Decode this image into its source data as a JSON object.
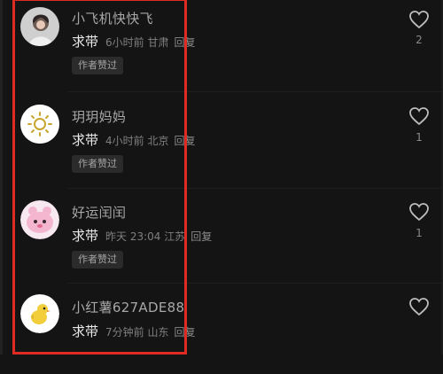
{
  "comments": [
    {
      "username": "小飞机快快飞",
      "content": "求带",
      "time": "6小时前",
      "location": "甘肃",
      "reply": "回复",
      "badge": "作者赞过",
      "likes": "2",
      "avatar": "portrait-avatar"
    },
    {
      "username": "玥玥妈妈",
      "content": "求带",
      "time": "4小时前",
      "location": "北京",
      "reply": "回复",
      "badge": "作者赞过",
      "likes": "1",
      "avatar": "sun-avatar"
    },
    {
      "username": "好运闰闰",
      "content": "求带",
      "time": "昨天 23:04",
      "location": "江苏",
      "reply": "回复",
      "badge": "作者赞过",
      "likes": "1",
      "avatar": "pink-character-avatar"
    },
    {
      "username": "小红薯627ADE88",
      "content": "求带",
      "time": "7分钟前",
      "location": "山东",
      "reply": "回复",
      "avatar": "chick-avatar"
    }
  ],
  "colors": {
    "highlight": "#e02b24",
    "background": "#141414"
  }
}
